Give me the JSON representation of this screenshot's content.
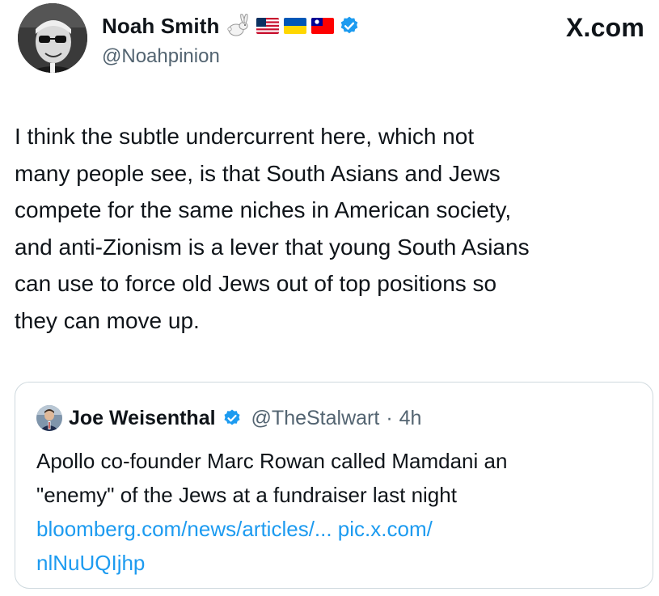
{
  "author": {
    "display_name": "Noah Smith",
    "handle": "@Noahpinion",
    "emoji_icons": [
      "rabbit-icon",
      "us-flag-icon",
      "ukraine-flag-icon",
      "taiwan-flag-icon"
    ],
    "verified_color": "#1d9bf0"
  },
  "brand": "X.com",
  "tweet": {
    "lines": [
      "I think the subtle undercurrent here, which not",
      "many people see, is that South Asians and Jews",
      "compete for the same niches in American society,",
      "and anti-Zionism is a lever that young South Asians",
      "can use to force old Jews out of top positions so",
      "they can move up."
    ]
  },
  "quote": {
    "display_name": "Joe Weisenthal",
    "handle": "@TheStalwart",
    "separator": "·",
    "time": "4h",
    "text_lines": [
      "Apollo co-founder Marc Rowan called Mamdani an",
      "\"enemy\" of the Jews at a fundraiser last night"
    ],
    "link_line_1": "bloomberg.com/news/articles/... pic.x.com/",
    "link_line_2": "nlNuUQIjhp",
    "link_color": "#1d9bf0"
  },
  "colors": {
    "text": "#0f1419",
    "secondary": "#536471",
    "border": "#cfd9de",
    "accent": "#1d9bf0"
  }
}
